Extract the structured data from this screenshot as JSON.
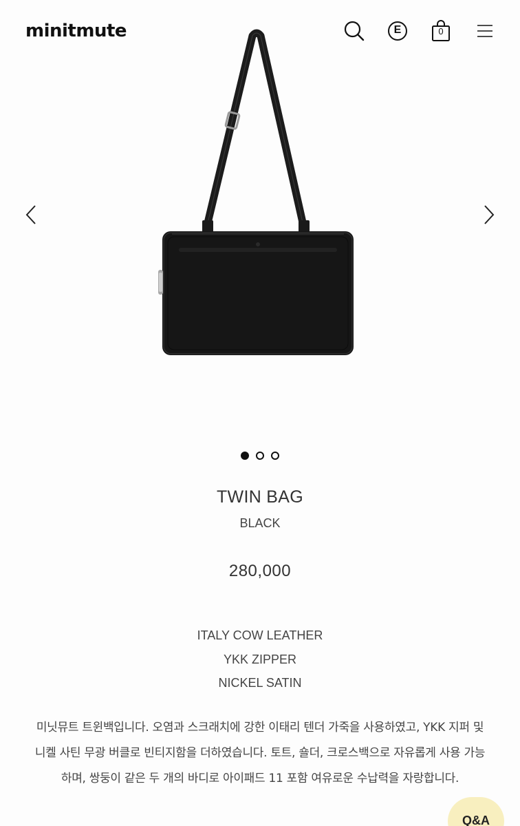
{
  "header": {
    "logo": "minitmute",
    "icons": [
      "search-icon",
      "e-icon",
      "shopping-bag-icon",
      "menu-icon"
    ],
    "e_label": "E",
    "cart_count": "0"
  },
  "gallery": {
    "image": "black-leather-shoulder-bag",
    "slide_count": 3,
    "active_slide": 1
  },
  "product": {
    "name": "TWIN BAG",
    "color": "BLACK",
    "price": "280,000",
    "features": [
      "ITALY COW LEATHER",
      "YKK ZIPPER",
      "NICKEL SATIN"
    ],
    "description": "미닛뮤트 트윈백입니다. 오염과 스크래치에 강한 이태리 텐더 가죽을 사용하였고, YKK 지퍼 및 니켈 사틴 무광 버클로 빈티지함을 더하였습니다. 토트, 숄더, 크로스백으로 자유롭게 사용 가능하며, 쌍둥이 같은 두 개의 바디로 아이패드 11 포함 여유로운 수납력을 자랑합니다."
  },
  "qa_button": {
    "label": "Q&A"
  }
}
